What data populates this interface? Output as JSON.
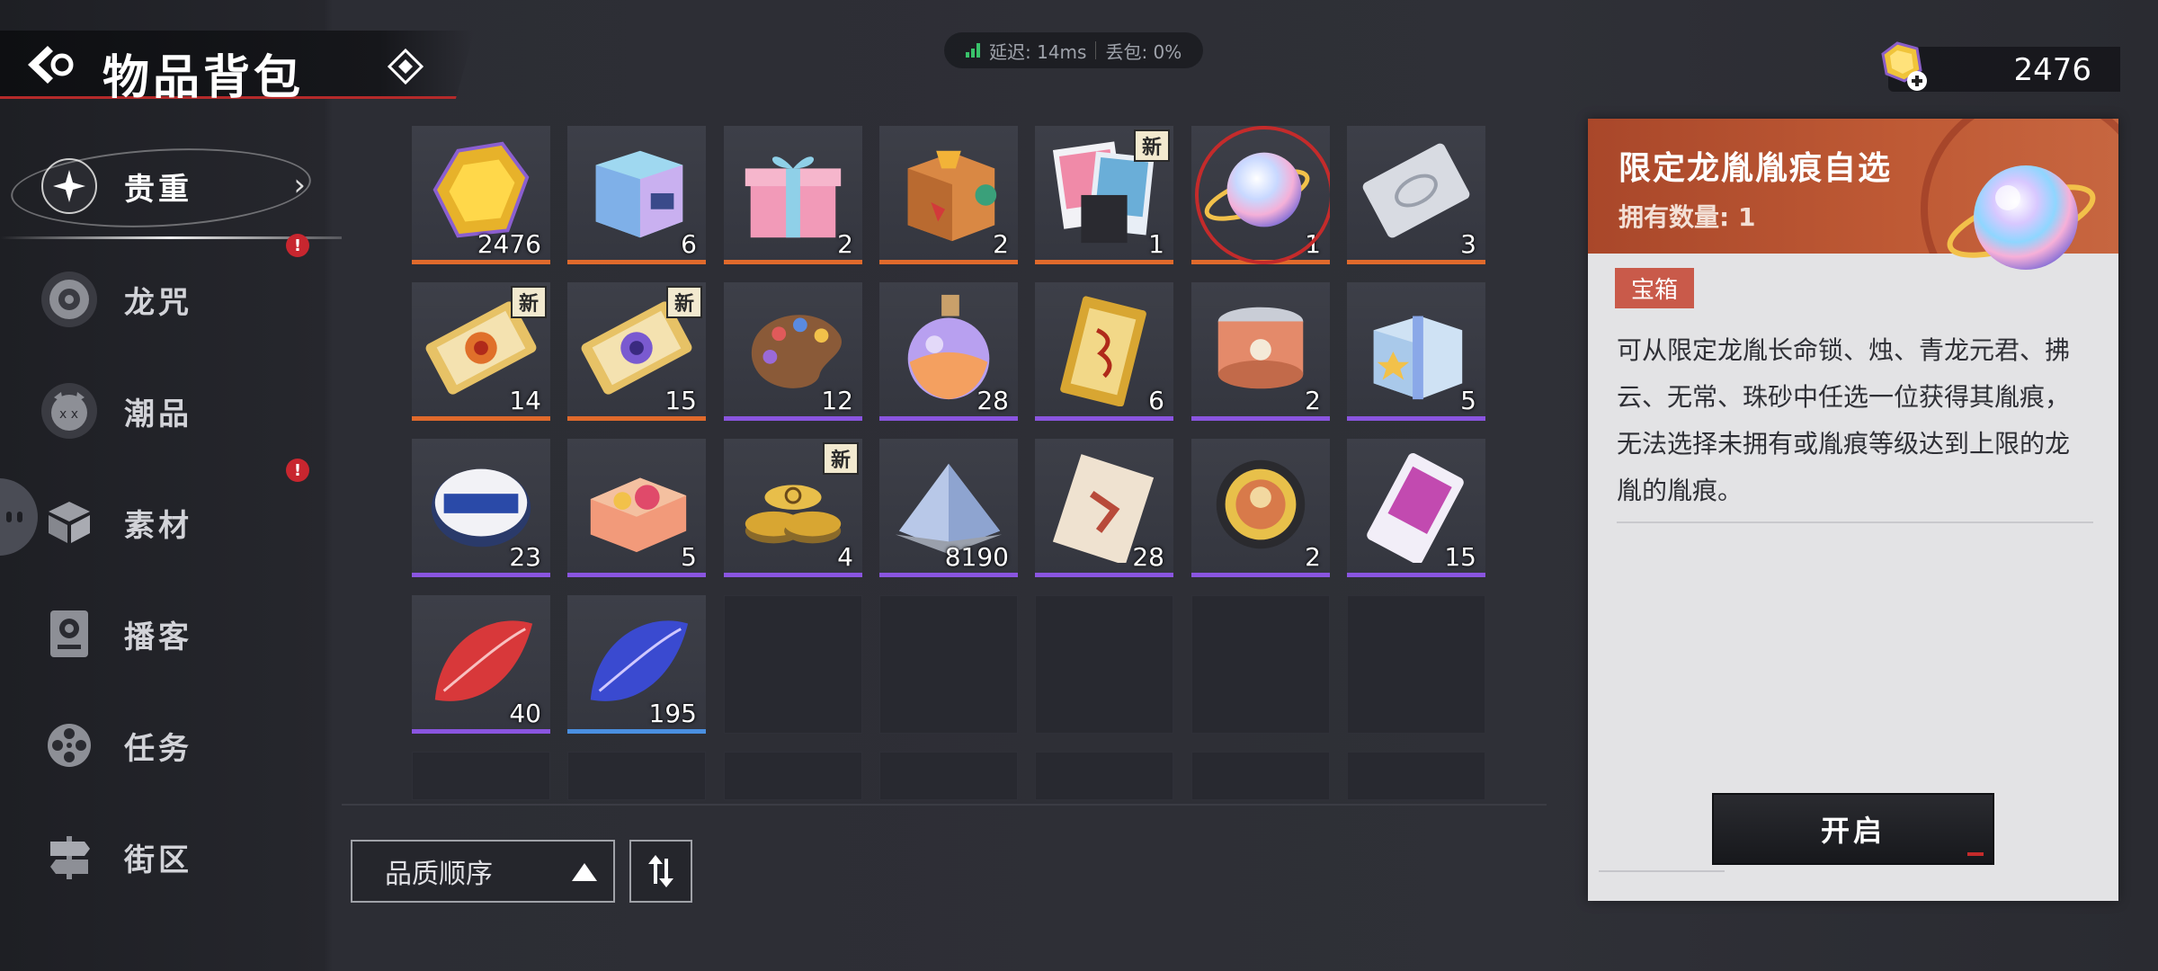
{
  "header": {
    "title": "物品背包",
    "back_icon": "back-arrow-icon",
    "menu_icon": "diamond-icon"
  },
  "network": {
    "latency": "延迟: 14ms",
    "packet_loss": "丢包: 0%"
  },
  "currency": {
    "amount": "2476",
    "icon": "gem-plus-icon"
  },
  "sidebar": {
    "items": [
      {
        "label": "贵重",
        "icon": "sparkle-icon",
        "active": true
      },
      {
        "label": "龙咒",
        "icon": "disc-icon",
        "alert": "!"
      },
      {
        "label": "潮品",
        "icon": "mask-icon"
      },
      {
        "label": "素材",
        "icon": "cube-icon",
        "alert": "!"
      },
      {
        "label": "播客",
        "icon": "speaker-icon"
      },
      {
        "label": "任务",
        "icon": "film-reel-icon"
      },
      {
        "label": "街区",
        "icon": "sign-icon"
      }
    ]
  },
  "items": [
    {
      "name": "yellow-gem",
      "count": "2476",
      "rarity": "orange"
    },
    {
      "name": "holo-cube",
      "count": "6",
      "rarity": "orange"
    },
    {
      "name": "pink-gift-box",
      "count": "2",
      "rarity": "orange"
    },
    {
      "name": "wooden-crate",
      "count": "2",
      "rarity": "orange"
    },
    {
      "name": "photo-cards",
      "count": "1",
      "rarity": "orange",
      "badge": "新"
    },
    {
      "name": "rainbow-orb",
      "count": "1",
      "rarity": "orange",
      "selected": true
    },
    {
      "name": "silver-ticket",
      "count": "3",
      "rarity": "orange"
    },
    {
      "name": "gold-ticket-red",
      "count": "14",
      "rarity": "orange",
      "badge": "新"
    },
    {
      "name": "gold-ticket-purple",
      "count": "15",
      "rarity": "orange",
      "badge": "新"
    },
    {
      "name": "paint-palette",
      "count": "12",
      "rarity": "purple"
    },
    {
      "name": "potion-bottle",
      "count": "28",
      "rarity": "purple"
    },
    {
      "name": "gold-plaque",
      "count": "6",
      "rarity": "purple"
    },
    {
      "name": "food-can",
      "count": "2",
      "rarity": "purple"
    },
    {
      "name": "blue-gift-box",
      "count": "5",
      "rarity": "purple"
    },
    {
      "name": "tin-badge",
      "count": "23",
      "rarity": "purple"
    },
    {
      "name": "candy-box",
      "count": "5",
      "rarity": "purple"
    },
    {
      "name": "gold-coins",
      "count": "4",
      "rarity": "purple",
      "badge": "新"
    },
    {
      "name": "sand-pile",
      "count": "8190",
      "rarity": "purple"
    },
    {
      "name": "paper-ticket",
      "count": "28",
      "rarity": "purple"
    },
    {
      "name": "chip-token",
      "count": "2",
      "rarity": "purple"
    },
    {
      "name": "pink-ticket",
      "count": "15",
      "rarity": "purple"
    },
    {
      "name": "red-leaf",
      "count": "40",
      "rarity": "purple"
    },
    {
      "name": "blue-leaf",
      "count": "195",
      "rarity": "blue"
    }
  ],
  "sort": {
    "label": "品质顺序",
    "dir_icon": "sort-direction-icon"
  },
  "detail": {
    "name": "限定龙胤胤痕自选",
    "owned": "拥有数量: 1",
    "tag": "宝箱",
    "description": "可从限定龙胤长命锁、烛、青龙元君、拂云、无常、珠砂中任选一位获得其胤痕，无法选择未拥有或胤痕等级达到上限的龙胤的胤痕。",
    "open_label": "开启"
  },
  "colors": {
    "rarity_orange": "#e06a2c",
    "rarity_purple": "#8a55e0",
    "rarity_blue": "#4a8fe0",
    "detail_header": "#b9502f",
    "alert": "#c8262f"
  }
}
